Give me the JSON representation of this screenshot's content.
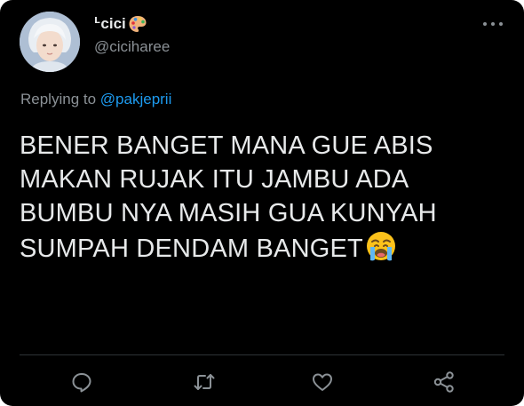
{
  "tweet": {
    "display_name": "ᒻcici",
    "name_emoji": "palette-emoji",
    "handle": "@ciciharee",
    "replying_prefix": "Replying to",
    "replying_to": "@pakjeprii",
    "text_lines": [
      "BENER BANGET MANA GUE ABIS",
      "MAKAN RUJAK ITU JAMBU ADA",
      "BUMBU NYA MASIH GUA KUNYAH",
      "SUMPAH DENDAM BANGET"
    ],
    "trailing_emoji": "loudly-crying-face-emoji"
  },
  "actions": [
    {
      "name": "reply",
      "icon": "reply-icon"
    },
    {
      "name": "retweet",
      "icon": "retweet-icon"
    },
    {
      "name": "like",
      "icon": "heart-icon"
    },
    {
      "name": "share",
      "icon": "share-icon"
    }
  ],
  "colors": {
    "background": "#000000",
    "primary_text": "#e7e9ea",
    "secondary_text": "#8b9196",
    "link": "#1d9bf0",
    "divider": "#2f3336"
  }
}
